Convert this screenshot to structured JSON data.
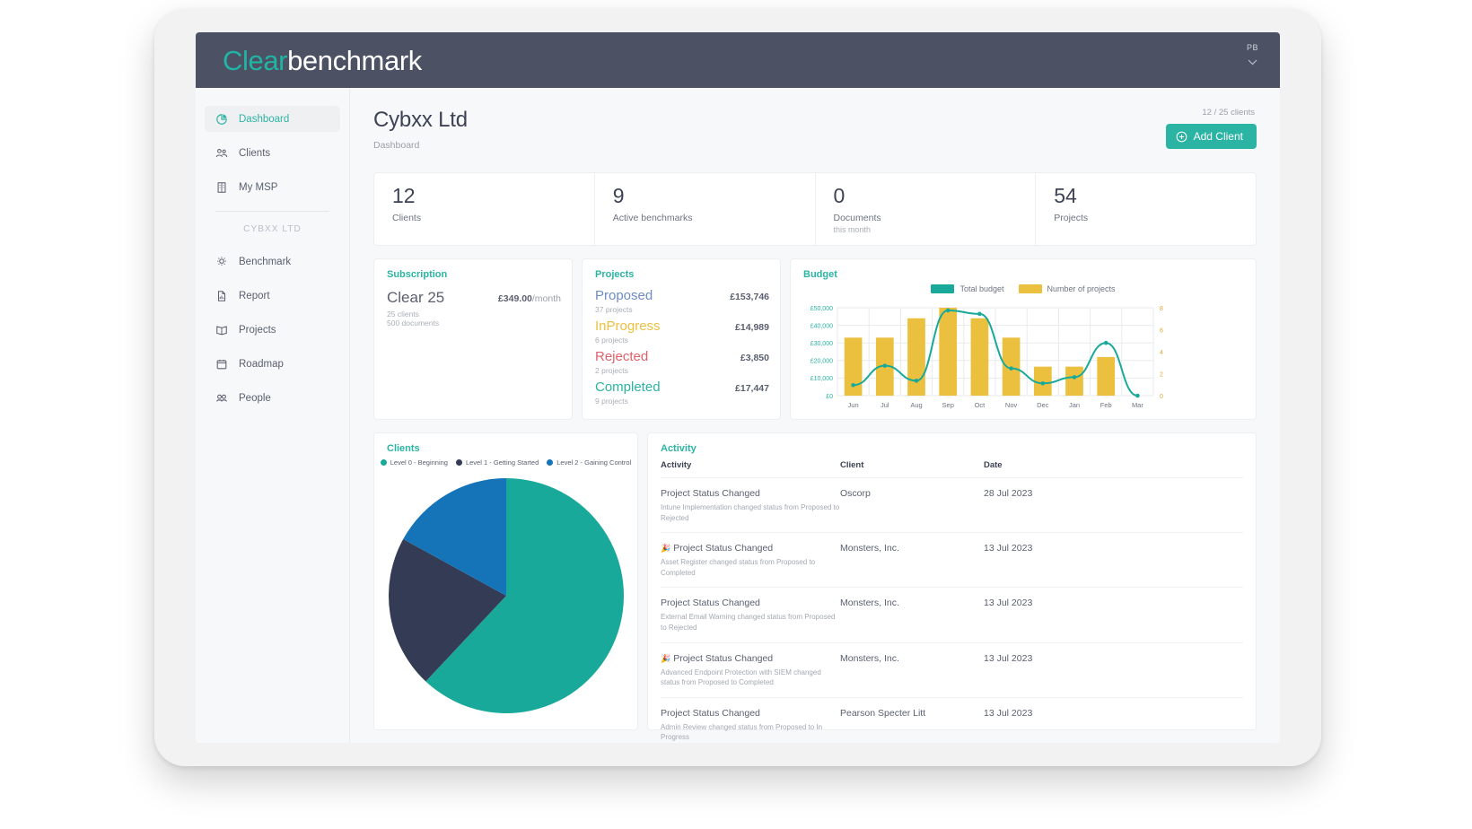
{
  "brand": {
    "part1": "Clear",
    "part2": "benchmark",
    "accent": "#21b4a4"
  },
  "header": {
    "avatar_initials": "PB",
    "chevron": "⌄"
  },
  "sidebar": {
    "items": [
      {
        "label": "Dashboard",
        "icon": "pie-chart-icon",
        "active": true
      },
      {
        "label": "Clients",
        "icon": "people-icon",
        "active": false
      },
      {
        "label": "My MSP",
        "icon": "building-icon",
        "active": false
      }
    ],
    "group_label": "CYBXX LTD",
    "group_items": [
      {
        "label": "Benchmark",
        "icon": "lightbulb-icon"
      },
      {
        "label": "Report",
        "icon": "document-chart-icon"
      },
      {
        "label": "Projects",
        "icon": "book-icon"
      },
      {
        "label": "Roadmap",
        "icon": "calendar-icon"
      },
      {
        "label": "People",
        "icon": "person-group-icon"
      }
    ]
  },
  "page": {
    "title": "Cybxx Ltd",
    "subtitle": "Dashboard",
    "clients_count": "12 / 25 clients",
    "add_client_label": "Add Client"
  },
  "stats": [
    {
      "value": "12",
      "label": "Clients",
      "sub": ""
    },
    {
      "value": "9",
      "label": "Active benchmarks",
      "sub": ""
    },
    {
      "value": "0",
      "label": "Documents",
      "sub": "this month"
    },
    {
      "value": "54",
      "label": "Projects",
      "sub": ""
    }
  ],
  "subscription": {
    "title": "Subscription",
    "plan": "Clear 25",
    "price": "£349.00",
    "price_period": "/month",
    "line1": "25 clients",
    "line2": "500 documents"
  },
  "projects": {
    "title": "Projects",
    "rows": [
      {
        "name": "Proposed",
        "count": "37 projects",
        "amount": "£153,746",
        "color": "#6e8cc4"
      },
      {
        "name": "InProgress",
        "count": "6 projects",
        "amount": "£14,989",
        "color": "#ecc03f"
      },
      {
        "name": "Rejected",
        "count": "2 projects",
        "amount": "£3,850",
        "color": "#e0616b"
      },
      {
        "name": "Completed",
        "count": "9 projects",
        "amount": "£17,447",
        "color": "#2bb3a3"
      }
    ]
  },
  "clients_chart": {
    "title": "Clients",
    "legend": [
      {
        "label": "Level 0 - Beginning",
        "color": "#18a99a"
      },
      {
        "label": "Level 1 - Getting Started",
        "color": "#333c54"
      },
      {
        "label": "Level 2 - Gaining Control",
        "color": "#1573b8"
      }
    ]
  },
  "activity": {
    "title": "Activity",
    "columns": [
      "Activity",
      "Client",
      "Date"
    ],
    "rows": [
      {
        "emoji": "",
        "title": "Project Status Changed",
        "desc": "Intune Implementation changed status from Proposed to Rejected",
        "client": "Oscorp",
        "date": "28 Jul 2023"
      },
      {
        "emoji": "🎉",
        "title": "Project Status Changed",
        "desc": "Asset Register changed status from Proposed to Completed",
        "client": "Monsters, Inc.",
        "date": "13 Jul 2023"
      },
      {
        "emoji": "",
        "title": "Project Status Changed",
        "desc": "External Email Warning changed status from Proposed to Rejected",
        "client": "Monsters, Inc.",
        "date": "13 Jul 2023"
      },
      {
        "emoji": "🎉",
        "title": "Project Status Changed",
        "desc": "Advanced Endpoint Protection with SIEM changed status from Proposed to Completed",
        "client": "Monsters, Inc.",
        "date": "13 Jul 2023"
      },
      {
        "emoji": "",
        "title": "Project Status Changed",
        "desc": "Admin Review changed status from Proposed to In Progress",
        "client": "Pearson Specter Litt",
        "date": "13 Jul 2023"
      }
    ]
  },
  "chart_data": [
    {
      "type": "bar",
      "title": "Budget",
      "categories": [
        "Jun",
        "Jul",
        "Aug",
        "Sep",
        "Oct",
        "Nov",
        "Dec",
        "Jan",
        "Feb",
        "Mar"
      ],
      "series": [
        {
          "name": "Number of projects",
          "type": "bar",
          "color": "#ecc03f",
          "values": [
            33000,
            33000,
            44000,
            50000,
            44000,
            33000,
            16500,
            16500,
            22000,
            0
          ],
          "axis": "left"
        },
        {
          "name": "Total budget",
          "type": "line",
          "color": "#18a99a",
          "values": [
            6000,
            17000,
            8500,
            48500,
            46500,
            15500,
            7000,
            10500,
            30000,
            0
          ],
          "axis": "left"
        }
      ],
      "legend": [
        {
          "label": "Total budget",
          "color": "#18a99a"
        },
        {
          "label": "Number of projects",
          "color": "#ecc03f"
        }
      ],
      "ylabel": "",
      "xlabel": "",
      "ylim": [
        0,
        50000
      ],
      "yticks": [
        "£0",
        "£10,000",
        "£20,000",
        "£30,000",
        "£40,000",
        "£50,000"
      ],
      "y2lim": [
        0,
        8
      ],
      "y2ticks": [
        "0",
        "2",
        "4",
        "6",
        "8"
      ],
      "grid": true,
      "legend_position": "top-center"
    },
    {
      "type": "pie",
      "title": "Clients",
      "labels": [
        "Level 0 - Beginning",
        "Level 1 - Getting Started",
        "Level 2 - Gaining Control"
      ],
      "values": [
        62,
        21,
        17
      ],
      "colors": [
        "#18a99a",
        "#333c54",
        "#1573b8"
      ],
      "legend_position": "top-center"
    }
  ]
}
